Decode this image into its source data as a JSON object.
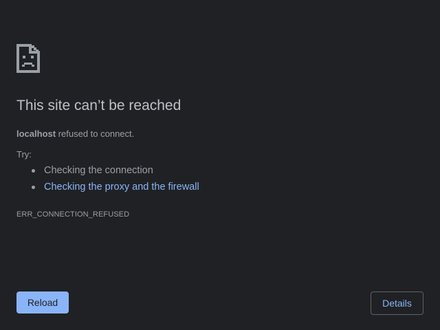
{
  "icon": "sad-page-icon",
  "heading": "This site can’t be reached",
  "summary": {
    "host": "localhost",
    "message": " refused to connect."
  },
  "try_label": "Try:",
  "suggestions": [
    {
      "label": "Checking the connection",
      "is_link": false
    },
    {
      "label": "Checking the proxy and the firewall",
      "is_link": true
    }
  ],
  "error_code": "ERR_CONNECTION_REFUSED",
  "buttons": {
    "reload": "Reload",
    "details": "Details"
  },
  "colors": {
    "background": "#202124",
    "text": "#9aa0a6",
    "heading": "#bdc1c6",
    "accent": "#8ab4f8"
  }
}
